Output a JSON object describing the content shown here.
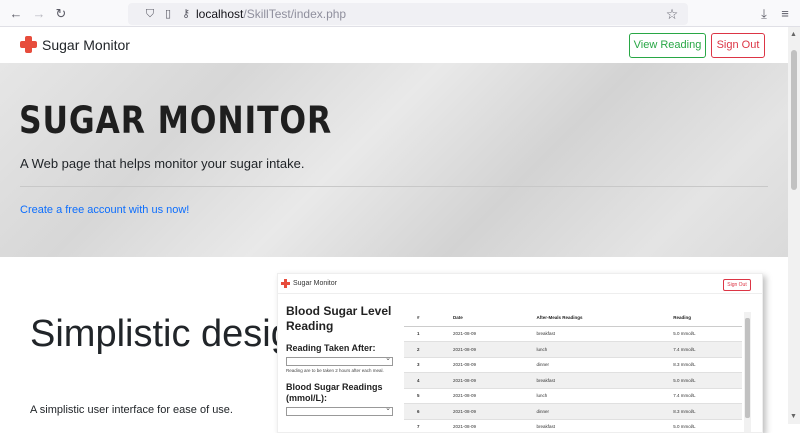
{
  "browser": {
    "url_host": "localhost",
    "url_path": "/SkillTest/index.php"
  },
  "navbar": {
    "brand": "Sugar Monitor",
    "view_reading_label": "View Reading",
    "sign_out_label": "Sign Out"
  },
  "hero": {
    "title": "SUGAR MONITOR",
    "subtitle": "A Web page that helps monitor your sugar intake.",
    "cta_link": "Create a free account with us now!"
  },
  "feature": {
    "title": "Simplistic design",
    "description": "A simplistic user interface for ease of use."
  },
  "preview": {
    "brand": "Sugar Monitor",
    "sign_out_label": "Sign Out",
    "form_heading": "Blood Sugar Level Reading",
    "taken_after_label": "Reading Taken After:",
    "taken_after_note": "Reading are to be taken 2 hours after each meal.",
    "readings_label": "Blood Sugar Readings (mmol/L):",
    "table": {
      "headers": [
        "#",
        "Date",
        "After-Meals Readings",
        "Reading"
      ],
      "rows": [
        [
          "1",
          "2021-08-09",
          "breakfast",
          "5.0 mmol/L"
        ],
        [
          "2",
          "2021-08-09",
          "lunch",
          "7.4 mmol/L"
        ],
        [
          "3",
          "2021-08-09",
          "dinner",
          "8.3 mmol/L"
        ],
        [
          "4",
          "2021-08-09",
          "breakfast",
          "5.0 mmol/L"
        ],
        [
          "5",
          "2021-08-09",
          "lunch",
          "7.4 mmol/L"
        ],
        [
          "6",
          "2021-08-09",
          "dinner",
          "8.3 mmol/L"
        ],
        [
          "7",
          "2021-08-09",
          "breakfast",
          "5.0 mmol/L"
        ]
      ]
    }
  },
  "colors": {
    "brand_red": "#e74c3c",
    "success": "#28a745",
    "danger": "#dc3545",
    "link": "#0d6efd"
  }
}
